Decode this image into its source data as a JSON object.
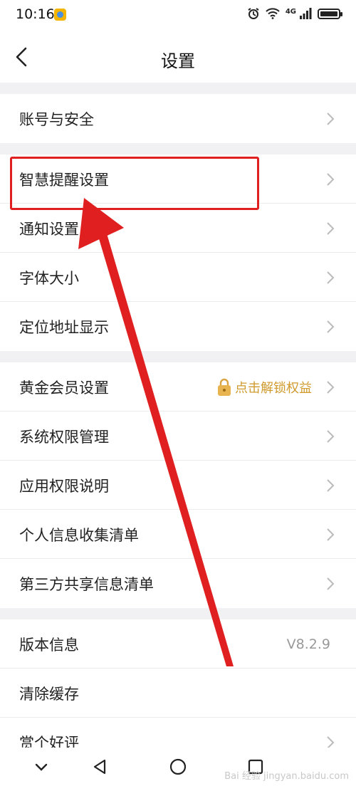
{
  "status": {
    "time": "10:16",
    "network": "4G"
  },
  "header": {
    "title": "设置"
  },
  "rows": [
    {
      "label": "账号与安全"
    },
    {
      "label": "智慧提醒设置"
    },
    {
      "label": "通知设置"
    },
    {
      "label": "字体大小"
    },
    {
      "label": "定位地址显示"
    },
    {
      "label": "黄金会员设置",
      "right_text": "点击解锁权益"
    },
    {
      "label": "系统权限管理"
    },
    {
      "label": "应用权限说明"
    },
    {
      "label": "个人信息收集清单"
    },
    {
      "label": "第三方共享信息清单"
    },
    {
      "label": "版本信息",
      "value": "V8.2.9"
    },
    {
      "label": "清除缓存"
    },
    {
      "label": "赏个好评"
    }
  ],
  "watermark": "Bai 经验 jingyan.baidu.com",
  "colors": {
    "accent_red": "#e02020",
    "gold": "#d09a2d",
    "section_gap": "#f1f1f3"
  }
}
